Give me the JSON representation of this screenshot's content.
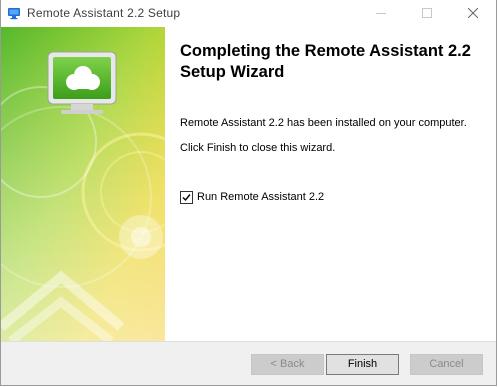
{
  "window": {
    "title": "Remote Assistant 2.2 Setup",
    "app_icon": "monitor-icon"
  },
  "titlebar_buttons": {
    "minimize_icon": "minimize-icon",
    "maximize_icon": "maximize-icon",
    "close_icon": "close-icon"
  },
  "banner": {
    "icon": "cloud-monitor-icon",
    "colors": {
      "green": "#5fbf2c",
      "yellow": "#f2d41a",
      "white": "#ffffff"
    }
  },
  "content": {
    "heading": "Completing the Remote Assistant 2.2 Setup Wizard",
    "installed_text": "Remote Assistant 2.2 has been installed on your computer.",
    "finish_text": "Click Finish to close this wizard.",
    "run_checkbox": {
      "label": "Run Remote Assistant 2.2",
      "checked": true
    }
  },
  "footer": {
    "back_label": "< Back",
    "finish_label": "Finish",
    "cancel_label": "Cancel"
  }
}
